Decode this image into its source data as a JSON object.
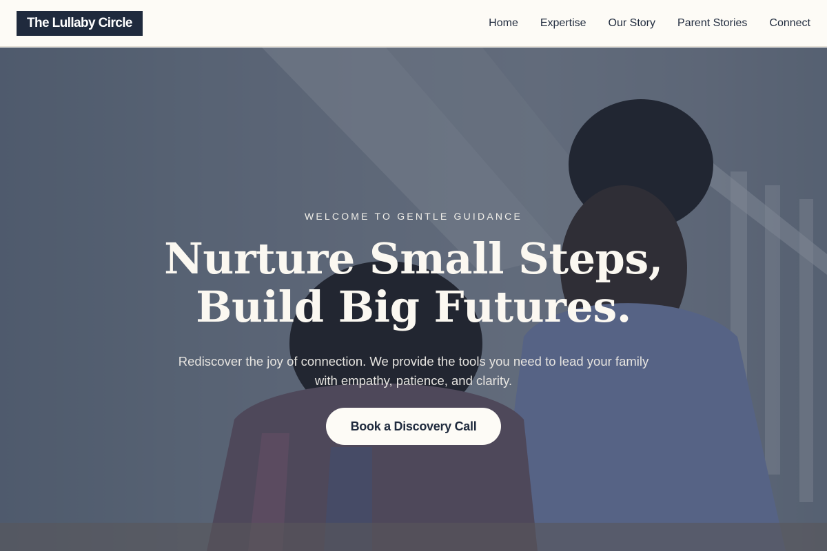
{
  "header": {
    "logo": "The Lullaby Circle",
    "nav": [
      {
        "label": "Home"
      },
      {
        "label": "Expertise"
      },
      {
        "label": "Our Story"
      },
      {
        "label": "Parent Stories"
      },
      {
        "label": "Connect"
      }
    ]
  },
  "hero": {
    "eyebrow": "WELCOME TO GENTLE GUIDANCE",
    "headline_line1": "Nurture Small Steps,",
    "headline_line2": "Build Big Futures.",
    "subtext": "Rediscover the joy of connection. We provide the tools you need to lead your family with empathy, patience, and clarity.",
    "cta_label": "Book a Discovery Call"
  },
  "colors": {
    "brand_navy": "#1f2a3d",
    "cream": "#fdfbf6",
    "overlay": "rgba(38,49,70,0.52)"
  }
}
